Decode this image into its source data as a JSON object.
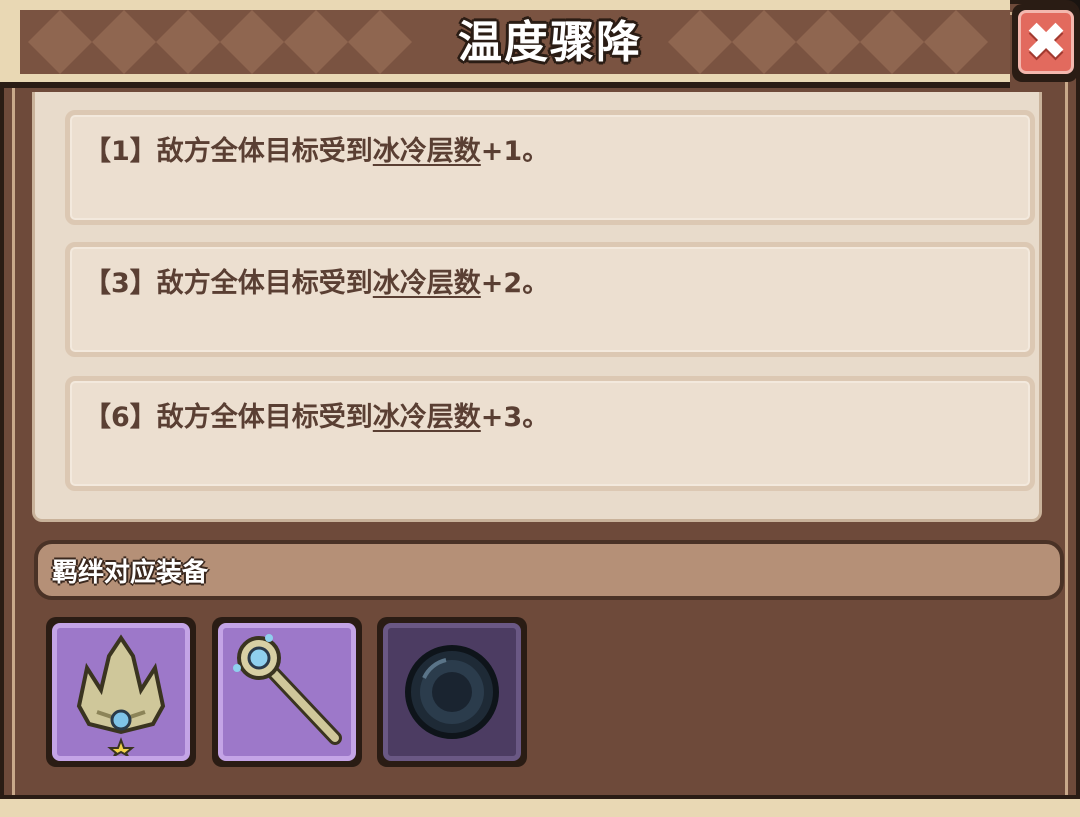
{
  "window": {
    "title": "温度骤降",
    "close_label": "✖"
  },
  "effects": [
    {
      "tier": "【1】",
      "prefix": "敌方全体目标受到",
      "keyword": "冰冷层数",
      "suffix": "+1。"
    },
    {
      "tier": "【3】",
      "prefix": "敌方全体目标受到",
      "keyword": "冰冷层数",
      "suffix": "+2。"
    },
    {
      "tier": "【6】",
      "prefix": "敌方全体目标受到",
      "keyword": "冰冷层数",
      "suffix": "+3。"
    }
  ],
  "bond": {
    "label": "羁绊对应装备",
    "items": [
      {
        "icon": "crown-icon",
        "state": "owned"
      },
      {
        "icon": "scepter-icon",
        "state": "owned"
      },
      {
        "icon": "dark-orb-icon",
        "state": "unowned"
      }
    ]
  },
  "colors": {
    "frame": "#6e4a3a",
    "panel": "#e8dbcb",
    "text": "#5a3f33",
    "close": "#e26a5e",
    "slot_owned": "#9d78c9",
    "slot_unowned": "#4c3c62"
  }
}
